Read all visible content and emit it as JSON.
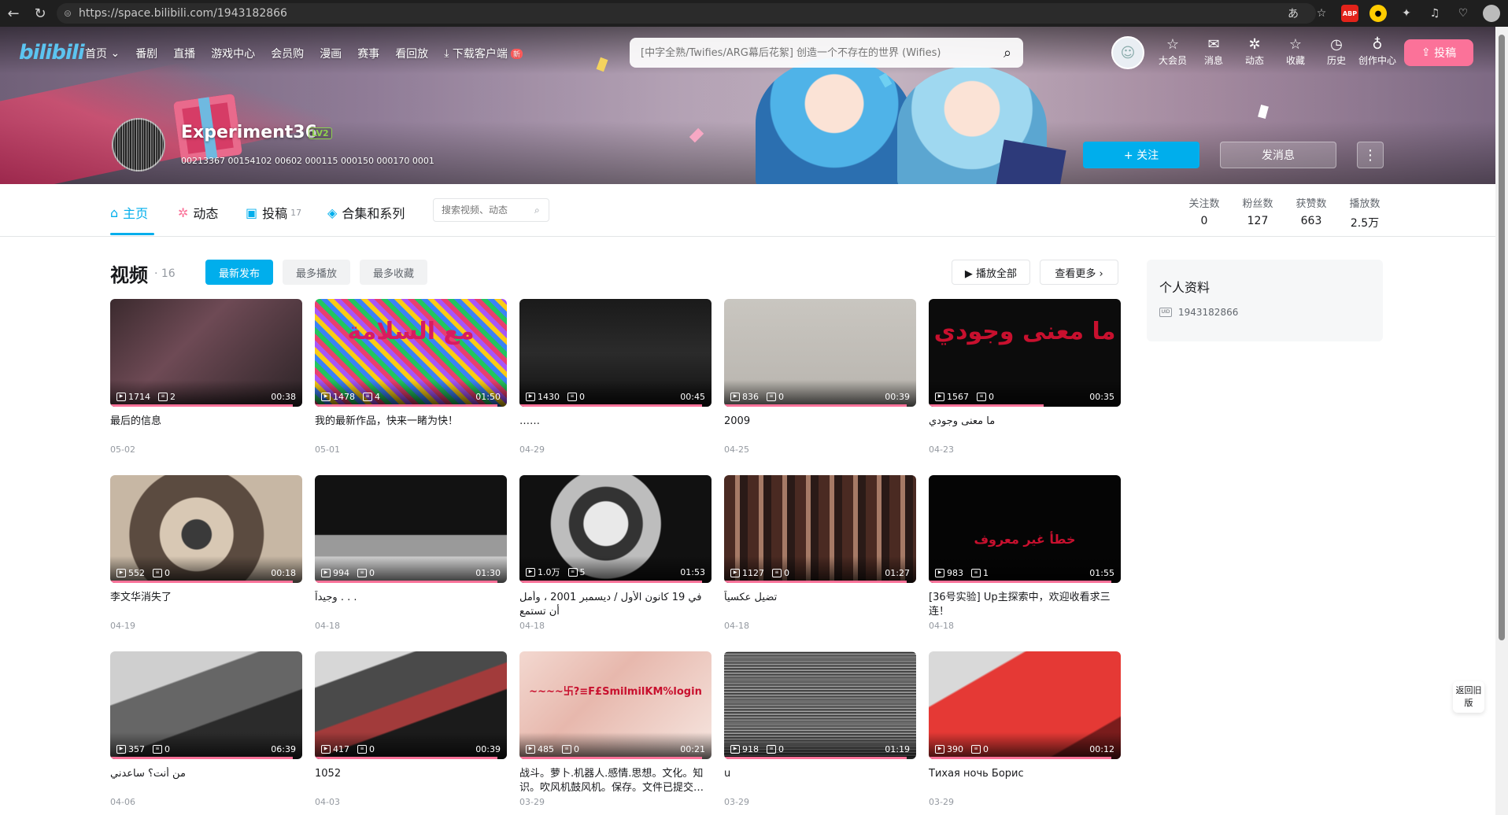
{
  "browser": {
    "url": "https://space.bilibili.com/1943182866",
    "back_icon": "arrow-left-icon",
    "reload_icon": "reload-icon"
  },
  "nav": {
    "logo": "bilibili",
    "items": [
      "首页",
      "番剧",
      "直播",
      "游戏中心",
      "会员购",
      "漫画",
      "赛事",
      "看回放",
      "下载客户端"
    ],
    "new_badge": "新",
    "search_placeholder": "[中字全熟/Twifies/ARG幕后花絮] 创造一个不存在的世界 (Wifies)",
    "user_icons": [
      {
        "label": "大会员",
        "glyph": "☆"
      },
      {
        "label": "消息",
        "glyph": "✉"
      },
      {
        "label": "动态",
        "glyph": "✲"
      },
      {
        "label": "收藏",
        "glyph": "☆"
      },
      {
        "label": "历史",
        "glyph": "◷"
      },
      {
        "label": "创作中心",
        "glyph": "♁"
      }
    ],
    "upload": "投稿"
  },
  "profile": {
    "name": "Experiment36",
    "level": "LV2",
    "sign": "00213367 00154102 00602 000115 000150 000170 0001",
    "follow": "+ 关注",
    "message": "发消息",
    "more": "⋮"
  },
  "tabs": {
    "home": "主页",
    "dynamic": "动态",
    "contrib": "投稿",
    "contrib_count": "17",
    "series": "合集和系列",
    "search_placeholder": "搜索视频、动态"
  },
  "stats": [
    {
      "label": "关注数",
      "value": "0"
    },
    {
      "label": "粉丝数",
      "value": "127"
    },
    {
      "label": "获赞数",
      "value": "663"
    },
    {
      "label": "播放数",
      "value": "2.5万"
    }
  ],
  "videos_section": {
    "title": "视频",
    "count": "· 16",
    "sort_latest": "最新发布",
    "sort_plays": "最多播放",
    "sort_favs": "最多收藏",
    "play_all": "▶ 播放全部",
    "see_more": "查看更多 ›"
  },
  "videos": [
    {
      "title": "最后的信息",
      "plays": "1714",
      "comments": "2",
      "duration": "00:38",
      "date": "05-02",
      "progress": 0.95
    },
    {
      "title": "我的最新作品，快来一睹为快！",
      "plays": "1478",
      "comments": "4",
      "duration": "01:50",
      "date": "05-01",
      "progress": 0.95,
      "overlay": "مع السلامة"
    },
    {
      "title": "……",
      "plays": "1430",
      "comments": "0",
      "duration": "00:45",
      "date": "04-29",
      "progress": 0.95
    },
    {
      "title": "2009",
      "plays": "836",
      "comments": "0",
      "duration": "00:39",
      "date": "04-25",
      "progress": 0.95
    },
    {
      "title": "ما معنى وجودي",
      "plays": "1567",
      "comments": "0",
      "duration": "00:35",
      "date": "04-23",
      "progress": 0.6,
      "overlay": "ما معنى وجودي"
    },
    {
      "title": "李文华消失了",
      "plays": "552",
      "comments": "0",
      "duration": "00:18",
      "date": "04-19",
      "progress": 0.95
    },
    {
      "title": "وجيداً . . .",
      "plays": "994",
      "comments": "0",
      "duration": "01:30",
      "date": "04-18",
      "progress": 0.95
    },
    {
      "title": "في 19 كانون الأول / ديسمبر 2001 ، وأمل أن تستمع",
      "plays": "1.0万",
      "comments": "5",
      "duration": "01:53",
      "date": "04-18",
      "progress": 0.95
    },
    {
      "title": "تضيل عكسياً",
      "plays": "1127",
      "comments": "0",
      "duration": "01:27",
      "date": "04-18",
      "progress": 0.95
    },
    {
      "title": "[36号实验] Up主探索中，欢迎收看求三连！",
      "plays": "983",
      "comments": "1",
      "duration": "01:55",
      "date": "04-18",
      "progress": 0.95,
      "overlay": "خطأ غير معروف"
    },
    {
      "title": "من أنت؟ ساعدني",
      "plays": "357",
      "comments": "0",
      "duration": "06:39",
      "date": "04-06",
      "progress": 0.95
    },
    {
      "title": "1052",
      "plays": "417",
      "comments": "0",
      "duration": "00:39",
      "date": "04-03",
      "progress": 0.95
    },
    {
      "title": "战斗。萝卜.机器人.感情.思想。文化。知识。吹风机鼓风机。保存。文件已提交…",
      "plays": "485",
      "comments": "0",
      "duration": "00:21",
      "date": "03-29",
      "progress": 0.95,
      "overlay": "~~~~卐?≡F£SmilmilKM%login"
    },
    {
      "title": "u",
      "plays": "918",
      "comments": "0",
      "duration": "01:19",
      "date": "03-29",
      "progress": 0.95
    },
    {
      "title": "Тихая ночь Борис",
      "plays": "390",
      "comments": "0",
      "duration": "00:12",
      "date": "03-29",
      "progress": 0.95
    }
  ],
  "sidebar": {
    "title": "个人资料",
    "uid_label": "UID",
    "uid": "1943182866"
  },
  "old_version": "返回旧版"
}
